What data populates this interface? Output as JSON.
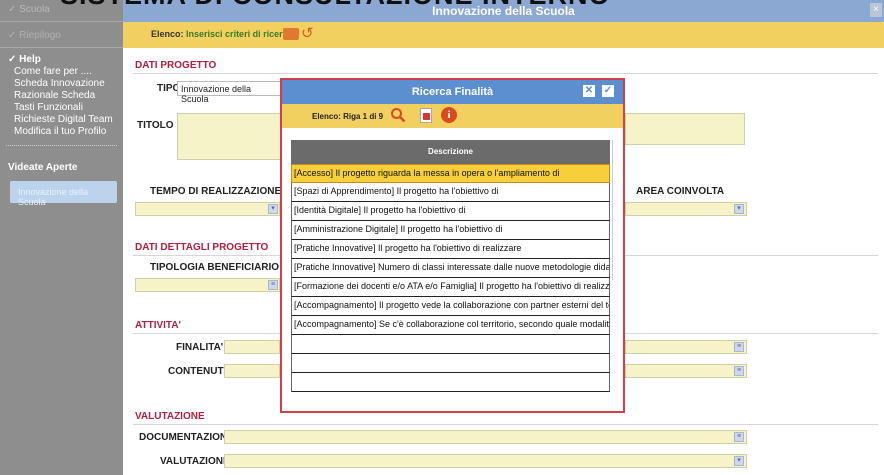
{
  "overlay": {
    "heading": "SISTEMA DI CONSULTAZIONE INTERNO"
  },
  "sidebar": {
    "top_item": "Scuola",
    "row2": "Riepilogo",
    "help_label": "Help",
    "items": [
      "Come fare per ....",
      "Scheda Innovazione",
      "Razionale Scheda",
      "Tasti Funzionali",
      "Richieste Digital Team",
      "Modifica il tuo Profilo"
    ],
    "open_label": "Videate Aperte",
    "open_item": "Innovazione della Scuola"
  },
  "header": {
    "title": "Innovazione della Scuola",
    "close": "×"
  },
  "toolbar": {
    "elenco_label": "Elenco:",
    "elenco_value": "Inserisci criteri di ricerca"
  },
  "form": {
    "dati_progetto": "DATI PROGETTO",
    "tipo_label": "TIPO",
    "tipo_value": "Innovazione della Scuola",
    "titolo_label": "TITOLO",
    "tempo_label": "TEMPO DI REALIZZAZIONE",
    "area_label": "AREA COINVOLTA",
    "dati_dettagli": "DATI DETTAGLI PROGETTO",
    "tipologia_label": "TIPOLOGIA BENEFICIARIO",
    "attivita": "ATTIVITA'",
    "finalita_label": "FINALITA'",
    "contenuti_label": "CONTENUTI",
    "valutazione_sec": "VALUTAZIONE",
    "documentazione_label": "DOCUMENTAZIONE",
    "valutazione_label": "VALUTAZIONE"
  },
  "modal": {
    "title": "Ricerca Finalità",
    "count": "Elenco: Riga 1 di 9",
    "column": "Descrizione",
    "rows": [
      "[Accesso] Il progetto riguarda la messa in opera o l'ampliamento di",
      "[Spazi di Apprendimento] Il progetto ha l'obiettivo di",
      "[Identità Digitale] Il progetto ha l'obiettivo di",
      "[Amministrazione Digitale] Il progetto ha l'obiettivo di",
      "[Pratiche Innovative] Il progetto ha l'obiettivo di realizzare",
      "[Pratiche Innovative] Numero di classi interessate dalle nuove metodologie didattiche",
      "[Formazione dei docenti e/o ATA e/o Famiglia] Il progetto ha l'obiettivo di realizzare",
      "[Accompagnamento] Il progetto vede la collaborazione con partner esterni del territorio",
      "[Accompagnamento] Se c'è collaborazione col territorio, secondo quale modalità?",
      "",
      "",
      ""
    ]
  }
}
